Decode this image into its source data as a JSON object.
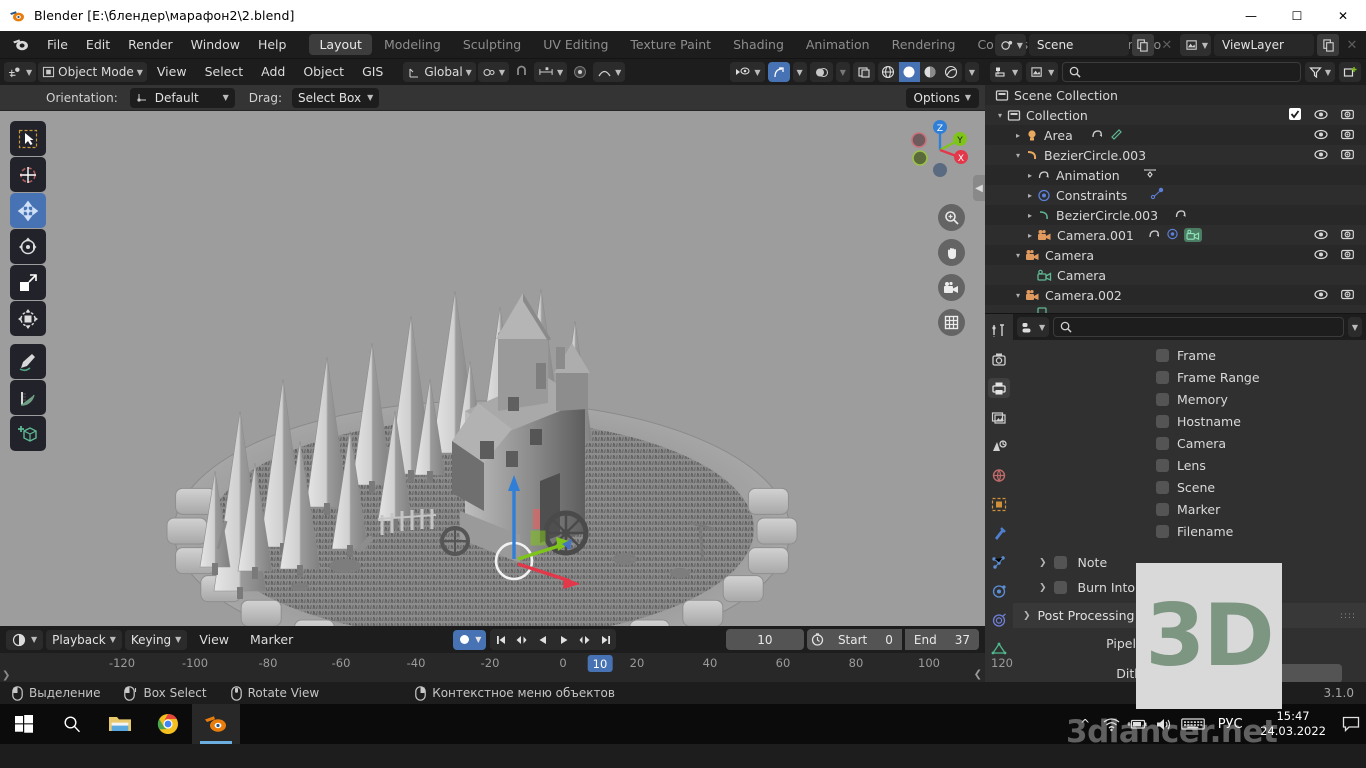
{
  "titlebar": {
    "title": "Blender [E:\\блендер\\марафон2\\2.blend]",
    "icon": "blender-logo-icon",
    "minimize": "—",
    "maximize": "☐",
    "close": "✕"
  },
  "menubar": {
    "items": [
      "File",
      "Edit",
      "Render",
      "Window",
      "Help"
    ],
    "workspaces": [
      {
        "label": "Layout",
        "active": true
      },
      {
        "label": "Modeling",
        "active": false
      },
      {
        "label": "Sculpting",
        "active": false
      },
      {
        "label": "UV Editing",
        "active": false
      },
      {
        "label": "Texture Paint",
        "active": false
      },
      {
        "label": "Shading",
        "active": false
      },
      {
        "label": "Animation",
        "active": false
      },
      {
        "label": "Rendering",
        "active": false
      },
      {
        "label": "Compositing",
        "active": false
      },
      {
        "label": "Geometry No",
        "active": false
      }
    ],
    "scene_name": "Scene",
    "viewlayer_name": "ViewLayer"
  },
  "viewport_header": {
    "mode": "Object Mode",
    "menus": [
      "View",
      "Select",
      "Add",
      "Object",
      "GIS"
    ],
    "transform_orientation": "Global",
    "orientation_label": "Orientation:",
    "orientation_value": "Default",
    "drag_label": "Drag:",
    "drag_value": "Select Box",
    "options": "Options"
  },
  "toolbar": {
    "tools": [
      {
        "name": "tweak-select-tool",
        "active": false
      },
      {
        "name": "cursor-tool",
        "active": false
      },
      {
        "name": "move-tool",
        "active": true
      },
      {
        "name": "rotate-tool",
        "active": false
      },
      {
        "name": "scale-tool",
        "active": false
      },
      {
        "name": "transform-tool",
        "active": false
      },
      {
        "name": "annotate-tool",
        "active": false
      },
      {
        "name": "measure-tool",
        "active": false
      },
      {
        "name": "add-cube-tool",
        "active": false
      }
    ]
  },
  "gizmo": {
    "axes": [
      {
        "label": "Z",
        "color": "#2f7fd8"
      },
      {
        "label": "Y",
        "color": "#7fc41b"
      },
      {
        "label": "X",
        "color": "#e2384a"
      }
    ],
    "nav_buttons": [
      "zoom-icon",
      "pan-hand-icon",
      "camera-view-icon",
      "toggle-ortho-grid-icon"
    ]
  },
  "outliner": {
    "search_placeholder": "",
    "rows": [
      {
        "label": "Scene Collection",
        "indent": 0,
        "icon": "collection-icon",
        "tri": "",
        "eye": false,
        "cam": false,
        "check": false
      },
      {
        "label": "Collection",
        "indent": 1,
        "icon": "collection-icon",
        "tri": "▾",
        "eye": true,
        "cam": true,
        "check": true
      },
      {
        "label": "Area",
        "indent": 2,
        "icon": "light-icon",
        "tri": "▸",
        "eye": true,
        "cam": true,
        "check": false,
        "extra": "anim-green"
      },
      {
        "label": "BezierCircle.003",
        "indent": 2,
        "icon": "curve-icon",
        "tri": "▾",
        "eye": true,
        "cam": true,
        "check": false
      },
      {
        "label": "Animation",
        "indent": 3,
        "icon": "animation-icon",
        "tri": "▸",
        "eye": false,
        "cam": false,
        "check": false,
        "extra": "keyframe"
      },
      {
        "label": "Constraints",
        "indent": 3,
        "icon": "constraint-icon",
        "tri": "▸",
        "eye": false,
        "cam": false,
        "check": false,
        "extra": "dot-line"
      },
      {
        "label": "BezierCircle.003",
        "indent": 3,
        "icon": "curve-data-icon",
        "tri": "▸",
        "eye": false,
        "cam": false,
        "check": false,
        "extra": "anim"
      },
      {
        "label": "Camera.001",
        "indent": 3,
        "icon": "camera-object-icon",
        "tri": "▸",
        "eye": true,
        "cam": true,
        "check": false,
        "extra": "cam-badges"
      },
      {
        "label": "Camera",
        "indent": 2,
        "icon": "camera-object-icon",
        "tri": "▾",
        "eye": true,
        "cam": true,
        "check": false
      },
      {
        "label": "Camera",
        "indent": 3,
        "icon": "camera-data-icon",
        "tri": "",
        "eye": false,
        "cam": false,
        "check": false
      },
      {
        "label": "Camera.002",
        "indent": 2,
        "icon": "camera-object-icon",
        "tri": "▾",
        "eye": true,
        "cam": true,
        "check": false
      }
    ]
  },
  "properties": {
    "search_placeholder": "",
    "tabs": [
      {
        "name": "tool-tab",
        "active": false
      },
      {
        "name": "render-tab",
        "active": false
      },
      {
        "name": "output-tab",
        "active": true
      },
      {
        "name": "view-layer-tab",
        "active": false
      },
      {
        "name": "scene-tab",
        "active": false
      },
      {
        "name": "world-tab",
        "active": false
      },
      {
        "name": "object-tab",
        "active": false
      },
      {
        "name": "modifier-tab",
        "active": false
      },
      {
        "name": "particles-tab",
        "active": false
      },
      {
        "name": "physics-tab",
        "active": false
      },
      {
        "name": "constraints-tab",
        "active": false
      },
      {
        "name": "object-data-tab",
        "active": false
      }
    ],
    "checkboxes": [
      {
        "label": "Frame",
        "checked": false
      },
      {
        "label": "Frame Range",
        "checked": false
      },
      {
        "label": "Memory",
        "checked": false
      },
      {
        "label": "Hostname",
        "checked": false
      },
      {
        "label": "Camera",
        "checked": false
      },
      {
        "label": "Lens",
        "checked": false
      },
      {
        "label": "Scene",
        "checked": false
      },
      {
        "label": "Marker",
        "checked": false
      },
      {
        "label": "Filename",
        "checked": false
      }
    ],
    "sections": [
      {
        "label": "Note",
        "checked": false
      },
      {
        "label": "Burn Into Ima",
        "checked": false
      }
    ],
    "post_processing": {
      "title": "Post Processing",
      "pipeline_label": "Pipeline",
      "dither_label": "Dither"
    }
  },
  "timeline": {
    "playback": "Playback",
    "keying": "Keying",
    "view": "View",
    "marker": "Marker",
    "current_frame": "10",
    "start_label": "Start",
    "start_value": "0",
    "end_label": "End",
    "end_value": "37",
    "ticks": [
      "-120",
      "-100",
      "-80",
      "-60",
      "-40",
      "-20",
      "0",
      "20",
      "40",
      "60",
      "80",
      "100",
      "120"
    ],
    "playhead_label": "10",
    "play_buttons": [
      "jump-start-icon",
      "prev-keyframe-icon",
      "play-reverse-icon",
      "play-icon",
      "next-keyframe-icon",
      "jump-end-icon"
    ]
  },
  "statusbar": {
    "items": [
      {
        "label": "Выделение",
        "icon": "mouse-left-icon"
      },
      {
        "label": "Box Select",
        "icon": "mouse-drag-icon"
      },
      {
        "label": "Rotate View",
        "icon": "mouse-middle-icon"
      },
      {
        "label": "Контекстное меню объектов",
        "icon": "mouse-right-icon"
      }
    ],
    "version": "3.1.0"
  },
  "taskbar": {
    "apps": [
      {
        "name": "start-button",
        "icon": "windows-logo-icon"
      },
      {
        "name": "search-button",
        "icon": "search-icon"
      },
      {
        "name": "file-explorer-button",
        "icon": "folder-icon"
      },
      {
        "name": "chrome-button",
        "icon": "chrome-icon"
      },
      {
        "name": "blender-taskbar-button",
        "icon": "blender-logo-icon"
      }
    ],
    "tray": {
      "chevron": "⌃",
      "icons": [
        "wifi-icon",
        "battery-icon",
        "volume-icon",
        "keyboard-icon"
      ],
      "language": "РУС",
      "time": "15:47",
      "date": "24.03.2022",
      "notifications": "notification-icon"
    }
  },
  "watermarks": {
    "logo_text": "3D",
    "site_text": "3dlancer.net"
  }
}
